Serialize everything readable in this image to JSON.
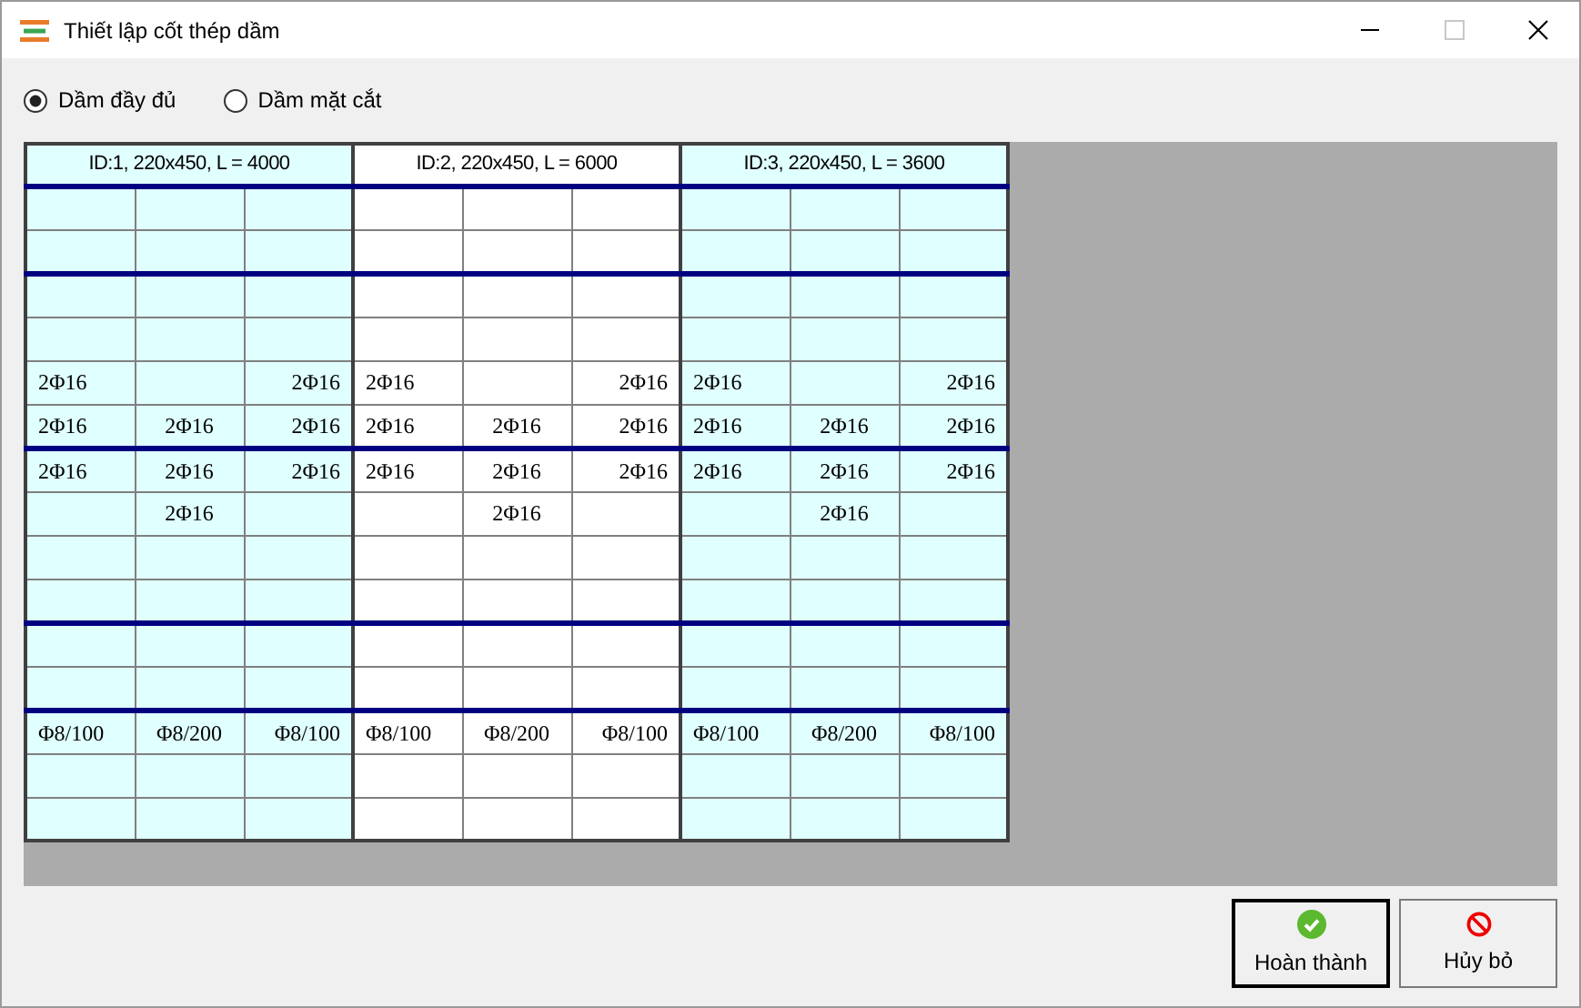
{
  "window": {
    "title": "Thiết lập cốt thép dầm"
  },
  "modes": [
    {
      "label": "Dầm đầy đủ",
      "selected": true
    },
    {
      "label": "Dầm mặt cắt",
      "selected": false
    }
  ],
  "beams": [
    {
      "header": "ID:1, 220x450, L = 4000",
      "highlighted": true
    },
    {
      "header": "ID:2, 220x450, L = 6000",
      "highlighted": false
    },
    {
      "header": "ID:3, 220x450, L = 3600",
      "highlighted": true
    }
  ],
  "rows": [
    {
      "section_start": true,
      "cells": [
        [
          null,
          null,
          null
        ],
        [
          null,
          null,
          null
        ],
        [
          null,
          null,
          null
        ]
      ]
    },
    {
      "section_start": false,
      "cells": [
        [
          null,
          null,
          null
        ],
        [
          null,
          null,
          null
        ],
        [
          null,
          null,
          null
        ]
      ]
    },
    {
      "section_start": true,
      "cells": [
        [
          null,
          null,
          null
        ],
        [
          null,
          null,
          null
        ],
        [
          null,
          null,
          null
        ]
      ]
    },
    {
      "section_start": false,
      "cells": [
        [
          null,
          null,
          null
        ],
        [
          null,
          null,
          null
        ],
        [
          null,
          null,
          null
        ]
      ]
    },
    {
      "section_start": false,
      "cells": [
        [
          "2Φ16",
          null,
          "2Φ16"
        ],
        [
          "2Φ16",
          null,
          "2Φ16"
        ],
        [
          "2Φ16",
          null,
          "2Φ16"
        ]
      ]
    },
    {
      "section_start": false,
      "cells": [
        [
          "2Φ16",
          "2Φ16",
          "2Φ16"
        ],
        [
          "2Φ16",
          "2Φ16",
          "2Φ16"
        ],
        [
          "2Φ16",
          "2Φ16",
          "2Φ16"
        ]
      ]
    },
    {
      "section_start": true,
      "cells": [
        [
          "2Φ16",
          "2Φ16",
          "2Φ16"
        ],
        [
          "2Φ16",
          "2Φ16",
          "2Φ16"
        ],
        [
          "2Φ16",
          "2Φ16",
          "2Φ16"
        ]
      ]
    },
    {
      "section_start": false,
      "cells": [
        [
          null,
          "2Φ16",
          null
        ],
        [
          null,
          "2Φ16",
          null
        ],
        [
          null,
          "2Φ16",
          null
        ]
      ]
    },
    {
      "section_start": false,
      "cells": [
        [
          null,
          null,
          null
        ],
        [
          null,
          null,
          null
        ],
        [
          null,
          null,
          null
        ]
      ]
    },
    {
      "section_start": false,
      "cells": [
        [
          null,
          null,
          null
        ],
        [
          null,
          null,
          null
        ],
        [
          null,
          null,
          null
        ]
      ]
    },
    {
      "section_start": true,
      "cells": [
        [
          null,
          null,
          null
        ],
        [
          null,
          null,
          null
        ],
        [
          null,
          null,
          null
        ]
      ]
    },
    {
      "section_start": false,
      "cells": [
        [
          null,
          null,
          null
        ],
        [
          null,
          null,
          null
        ],
        [
          null,
          null,
          null
        ]
      ]
    },
    {
      "section_start": true,
      "cells": [
        [
          "Φ8/100",
          "Φ8/200",
          "Φ8/100"
        ],
        [
          "Φ8/100",
          "Φ8/200",
          "Φ8/100"
        ],
        [
          "Φ8/100",
          "Φ8/200",
          "Φ8/100"
        ]
      ]
    },
    {
      "section_start": false,
      "cells": [
        [
          null,
          null,
          null
        ],
        [
          null,
          null,
          null
        ],
        [
          null,
          null,
          null
        ]
      ]
    },
    {
      "section_start": false,
      "cells": [
        [
          null,
          null,
          null
        ],
        [
          null,
          null,
          null
        ],
        [
          null,
          null,
          null
        ]
      ]
    }
  ],
  "buttons": [
    {
      "kind": "confirm",
      "label": "Hoàn thành",
      "default": true
    },
    {
      "kind": "cancel",
      "label": "Hủy bỏ",
      "default": false
    }
  ]
}
